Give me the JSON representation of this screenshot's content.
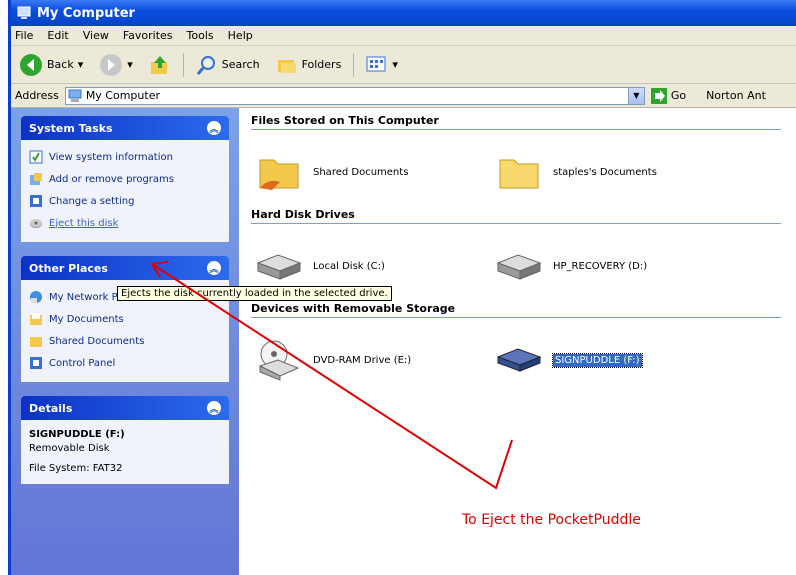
{
  "window": {
    "title": "My Computer"
  },
  "menu": [
    "File",
    "Edit",
    "View",
    "Favorites",
    "Tools",
    "Help"
  ],
  "toolbar": {
    "back": "Back",
    "search": "Search",
    "folders": "Folders"
  },
  "address": {
    "label": "Address",
    "value": "My Computer",
    "go": "Go",
    "norton": "Norton Ant"
  },
  "system_tasks": {
    "title": "System Tasks",
    "items": [
      {
        "label": "View system information"
      },
      {
        "label": "Add or remove programs"
      },
      {
        "label": "Change a setting"
      },
      {
        "label": "Eject this disk"
      }
    ]
  },
  "other_places": {
    "title": "Other Places",
    "items": [
      {
        "label": "My Network Places"
      },
      {
        "label": "My Documents"
      },
      {
        "label": "Shared Documents"
      },
      {
        "label": "Control Panel"
      }
    ]
  },
  "details": {
    "title": "Details",
    "name": "SIGNPUDDLE (F:)",
    "type": "Removable Disk",
    "fs": "File System: FAT32"
  },
  "groups": {
    "files": {
      "title": "Files Stored on This Computer",
      "items": [
        "Shared Documents",
        "staples's Documents"
      ]
    },
    "hdd": {
      "title": "Hard Disk Drives",
      "items": [
        "Local Disk (C:)",
        "HP_RECOVERY (D:)"
      ]
    },
    "removable": {
      "title": "Devices with Removable Storage",
      "items": [
        "DVD-RAM Drive (E:)",
        "SIGNPUDDLE (F:)"
      ]
    }
  },
  "tooltip": "Ejects the disk currently loaded in the selected drive.",
  "annotation": "To Eject the PocketPuddle",
  "colors": {
    "accent": "#316ac5",
    "annotation": "#e00000",
    "taskpane": "#7ba2e7"
  }
}
